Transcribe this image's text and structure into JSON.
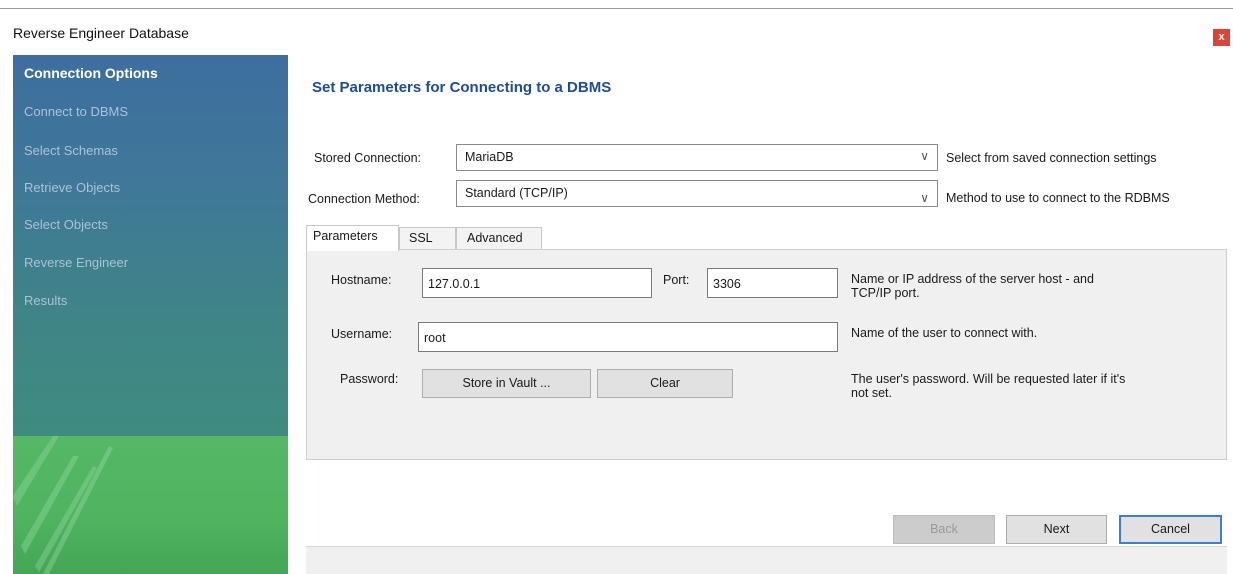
{
  "window": {
    "title": "Reverse Engineer Database",
    "close_label": "x"
  },
  "sidebar": {
    "items": [
      {
        "label": "Connection Options",
        "active": true
      },
      {
        "label": "Connect to DBMS",
        "active": false
      },
      {
        "label": "Select Schemas",
        "active": false
      },
      {
        "label": "Retrieve Objects",
        "active": false
      },
      {
        "label": "Select Objects",
        "active": false
      },
      {
        "label": "Reverse Engineer",
        "active": false
      },
      {
        "label": "Results",
        "active": false
      }
    ]
  },
  "main": {
    "heading": "Set Parameters for Connecting to a DBMS",
    "stored_connection": {
      "label": "Stored Connection:",
      "value": "MariaDB",
      "hint": "Select from saved connection settings"
    },
    "connection_method": {
      "label": "Connection Method:",
      "value": "Standard (TCP/IP)",
      "hint": "Method to use to connect to the RDBMS"
    },
    "tabs": [
      {
        "label": "Parameters",
        "selected": true
      },
      {
        "label": "SSL",
        "selected": false
      },
      {
        "label": "Advanced",
        "selected": false
      }
    ],
    "hostname": {
      "label": "Hostname:",
      "value": "127.0.0.1"
    },
    "port": {
      "label": "Port:",
      "value": "3306",
      "hint_line1": "Name or IP address of the server host - and",
      "hint_line2": "TCP/IP port."
    },
    "username": {
      "label": "Username:",
      "value": "root",
      "hint": "Name of the user to connect with."
    },
    "password": {
      "label": "Password:",
      "store_button": "Store in Vault ...",
      "clear_button": "Clear",
      "hint_line1": "The user's password. Will be requested later if it's",
      "hint_line2": "not set."
    }
  },
  "footer": {
    "back": "Back",
    "next": "Next",
    "cancel": "Cancel"
  },
  "colors": {
    "heading": "#1c4c9a",
    "sidebar_top": "#3e6e9f",
    "sidebar_bottom": "#3c8b76",
    "sidebar_green": "#55b866",
    "close_button": "#d9453b",
    "default_button_border": "#3a7fd5"
  }
}
